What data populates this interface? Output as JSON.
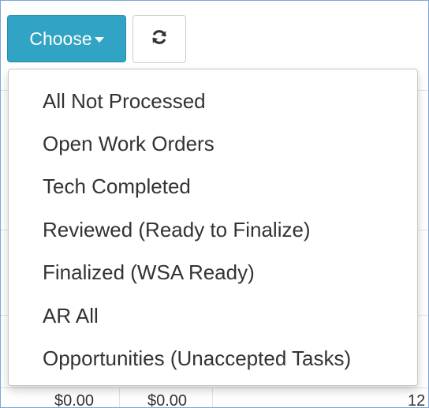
{
  "toolbar": {
    "choose_label": "Choose",
    "refresh_icon": "refresh-icon",
    "accent_color": "#31a3c4"
  },
  "dropdown": {
    "items": [
      "All Not Processed",
      "Open Work Orders",
      "Tech Completed",
      "Reviewed (Ready to Finalize)",
      "Finalized (WSA Ready)",
      "AR All",
      "Opportunities (Unaccepted Tasks)"
    ]
  },
  "table": {
    "partial_row": [
      "$0.00",
      "$0.00",
      "12"
    ]
  }
}
